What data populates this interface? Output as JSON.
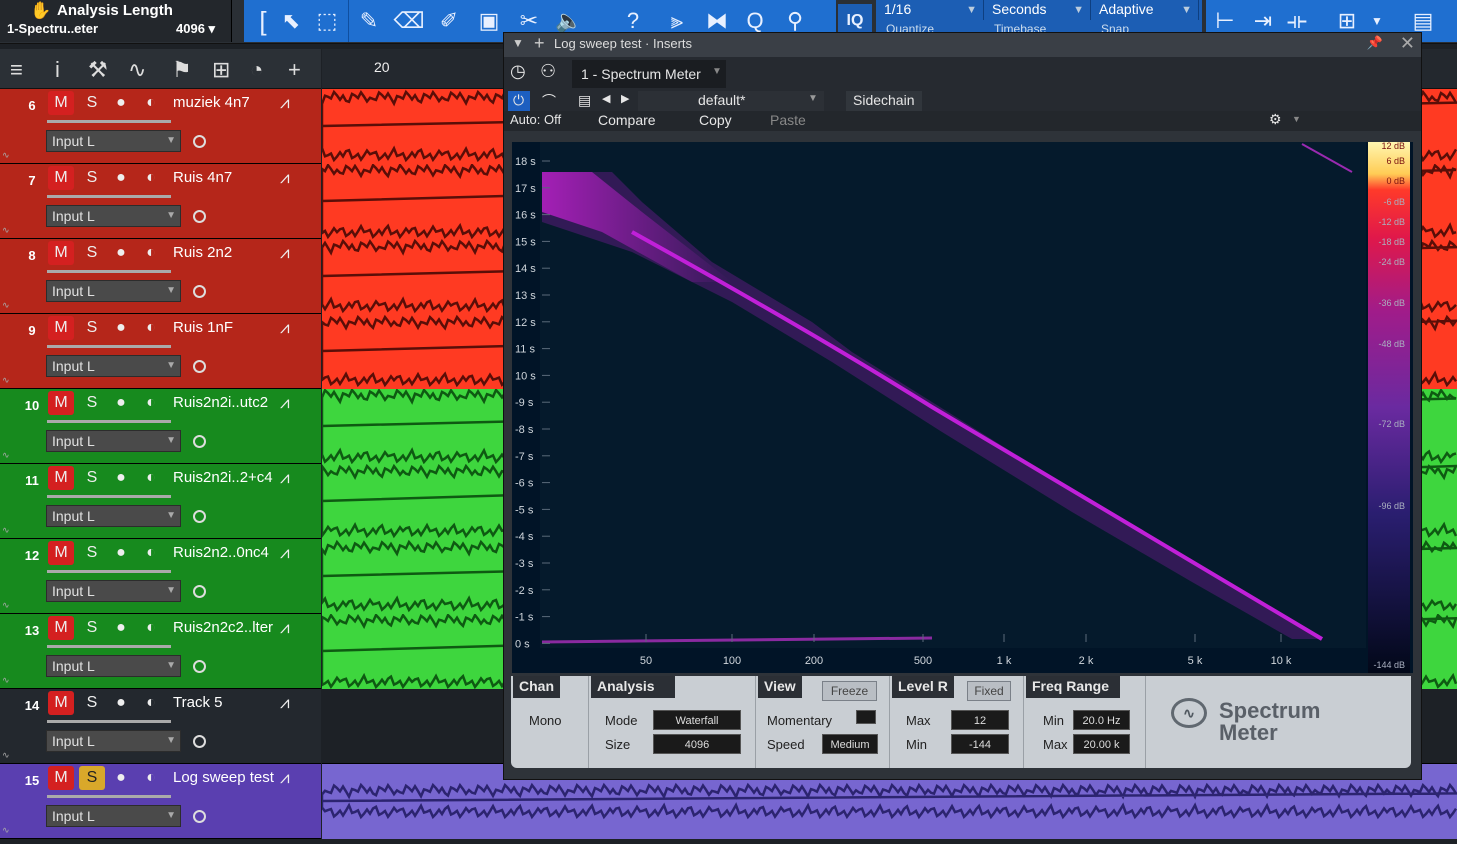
{
  "toolbar": {
    "analysis_title": "Analysis Length",
    "analysis_plugin": "1-Spectru..eter",
    "analysis_value": "4096",
    "quantize": "1/16",
    "quantize_label": "Quantize",
    "timebase": "Seconds",
    "timebase_label": "Timebase",
    "snap": "Adaptive",
    "snap_label": "Snap",
    "iq": "IQ"
  },
  "ruler": {
    "mark": "20"
  },
  "tracks": [
    {
      "num": "6",
      "name": "muziek 4n7",
      "input": "Input L",
      "color": "#b5261a",
      "solo": false
    },
    {
      "num": "7",
      "name": "Ruis 4n7",
      "input": "Input L",
      "color": "#b5261a",
      "solo": false
    },
    {
      "num": "8",
      "name": "Ruis 2n2",
      "input": "Input L",
      "color": "#b5261a",
      "solo": false
    },
    {
      "num": "9",
      "name": "Ruis 1nF",
      "input": "Input L",
      "color": "#b5261a",
      "solo": false
    },
    {
      "num": "10",
      "name": "Ruis2n2i..utc2",
      "input": "Input L",
      "color": "#178a1e",
      "solo": false
    },
    {
      "num": "11",
      "name": "Ruis2n2i..2+c4",
      "input": "Input L",
      "color": "#178a1e",
      "solo": false
    },
    {
      "num": "12",
      "name": "Ruis2n2..0nc4",
      "input": "Input L",
      "color": "#178a1e",
      "solo": false
    },
    {
      "num": "13",
      "name": "Ruis2n2c2..lter",
      "input": "Input L",
      "color": "#178a1e",
      "solo": false
    },
    {
      "num": "14",
      "name": "Track 5",
      "input": "Input L",
      "color": "#23282e",
      "solo": false
    },
    {
      "num": "15",
      "name": "Log sweep test",
      "input": "Input L",
      "color": "#5a3fb0",
      "solo": true
    }
  ],
  "buttons": {
    "mute": "M",
    "solo": "S"
  },
  "plugin": {
    "title": "Log sweep test · Inserts",
    "insert": "1 - Spectrum Meter",
    "preset": "default*",
    "sidechain": "Sidechain",
    "auto": "Auto: Off",
    "compare": "Compare",
    "copy": "Copy",
    "paste": "Paste"
  },
  "spectrum": {
    "y_labels": [
      "18 s",
      "17 s",
      "16 s",
      "15 s",
      "14 s",
      "13 s",
      "12 s",
      "11 s",
      "10 s",
      "-9 s",
      "-8 s",
      "-7 s",
      "-6 s",
      "-5 s",
      "-4 s",
      "-3 s",
      "-2 s",
      "-1 s",
      "0 s"
    ],
    "x_labels": [
      "50",
      "100",
      "200",
      "500",
      "1 k",
      "2 k",
      "5 k",
      "10 k"
    ],
    "db_labels": [
      "12 dB",
      "6 dB",
      "0 dB",
      "-6 dB",
      "-12 dB",
      "-18 dB",
      "-24 dB",
      "-36 dB",
      "-48 dB",
      "-72 dB",
      "-96 dB",
      "-144 dB"
    ]
  },
  "controls": {
    "chan_hd": "Chan",
    "chan_val": "Mono",
    "analysis_hd": "Analysis",
    "mode_lbl": "Mode",
    "mode_val": "Waterfall",
    "size_lbl": "Size",
    "size_val": "4096",
    "view_hd": "View",
    "freeze": "Freeze",
    "momentary": "Momentary",
    "speed_lbl": "Speed",
    "speed_val": "Medium",
    "level_hd": "Level R",
    "fixed": "Fixed",
    "max_lbl": "Max",
    "max_val": "12",
    "min_lbl": "Min",
    "min_val": "-144",
    "freq_hd": "Freq Range",
    "fmin_lbl": "Min",
    "fmin_val": "20.0 Hz",
    "fmax_lbl": "Max",
    "fmax_val": "20.00 k",
    "logo_line1": "Spectrum",
    "logo_line2": "Meter"
  }
}
